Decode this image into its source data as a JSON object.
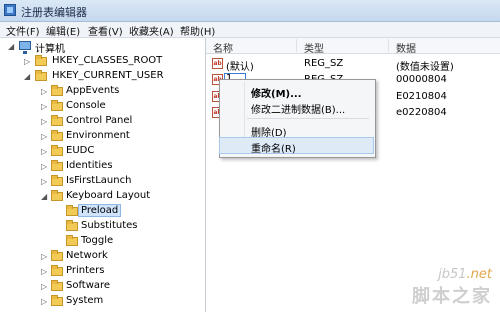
{
  "window": {
    "title": "注册表编辑器",
    "icon": "regedit-icon"
  },
  "menu": [
    "文件(F)",
    "编辑(E)",
    "查看(V)",
    "收藏夹(A)",
    "帮助(H)"
  ],
  "tree": {
    "root": "计算机",
    "hkcr": "HKEY_CLASSES_ROOT",
    "hkcu": "HKEY_CURRENT_USER",
    "hkcu_children": [
      "AppEvents",
      "Console",
      "Control Panel",
      "Environment",
      "EUDC",
      "Identities",
      "IsFirstLaunch"
    ],
    "keyboard_layout": "Keyboard Layout",
    "keyboard_children": [
      "Preload",
      "Substitutes",
      "Toggle"
    ],
    "after": [
      "Network",
      "Printers",
      "Software",
      "System"
    ],
    "selected": "Preload"
  },
  "list": {
    "headers": {
      "name": "名称",
      "type": "类型",
      "data": "数据"
    },
    "rows": [
      {
        "name": "(默认)",
        "type": "REG_SZ",
        "data": "(数值未设置)"
      },
      {
        "name": "1",
        "type": "REG_SZ",
        "data": "00000804"
      },
      {
        "name": "",
        "type": "",
        "data": "E0210804"
      },
      {
        "name": "",
        "type": "",
        "data": "e0220804"
      }
    ],
    "editing_value": "1"
  },
  "context_menu": {
    "items": [
      "修改(M)...",
      "修改二进制数据(B)...",
      "删除(D)",
      "重命名(R)"
    ],
    "highlighted": "重命名(R)"
  },
  "watermark": {
    "site": "jb51",
    "tld": ".net",
    "name": "脚本之家"
  }
}
